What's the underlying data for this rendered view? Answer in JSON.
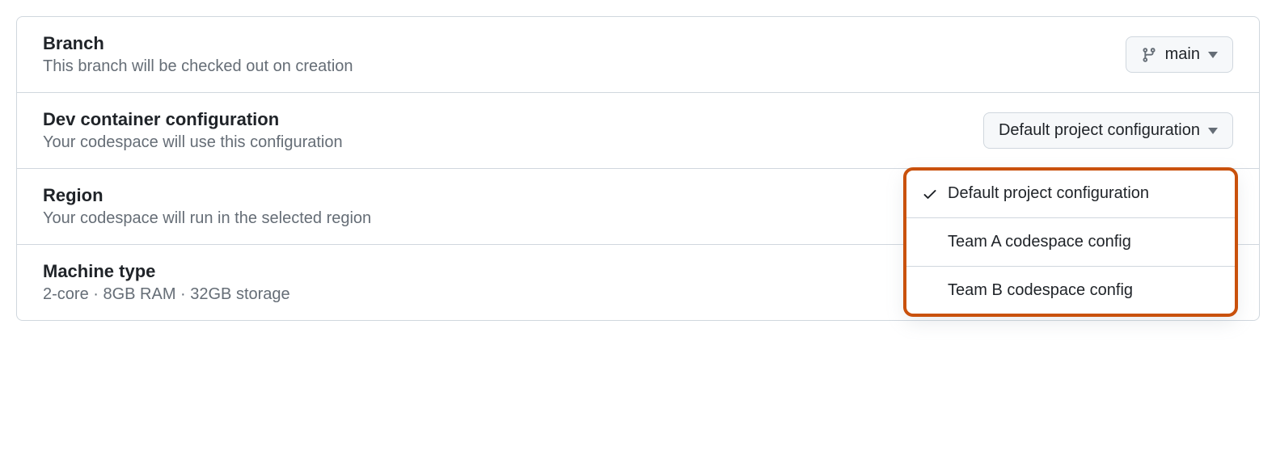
{
  "branch": {
    "title": "Branch",
    "desc": "This branch will be checked out on creation",
    "selected": "main"
  },
  "devcontainer": {
    "title": "Dev container configuration",
    "desc": "Your codespace will use this configuration",
    "selected": "Default project configuration",
    "options": [
      "Default project configuration",
      "Team A codespace config",
      "Team B codespace config"
    ]
  },
  "region": {
    "title": "Region",
    "desc": "Your codespace will run in the selected region"
  },
  "machine": {
    "title": "Machine type",
    "desc": "2-core · 8GB RAM · 32GB storage",
    "selected": "2-core"
  }
}
